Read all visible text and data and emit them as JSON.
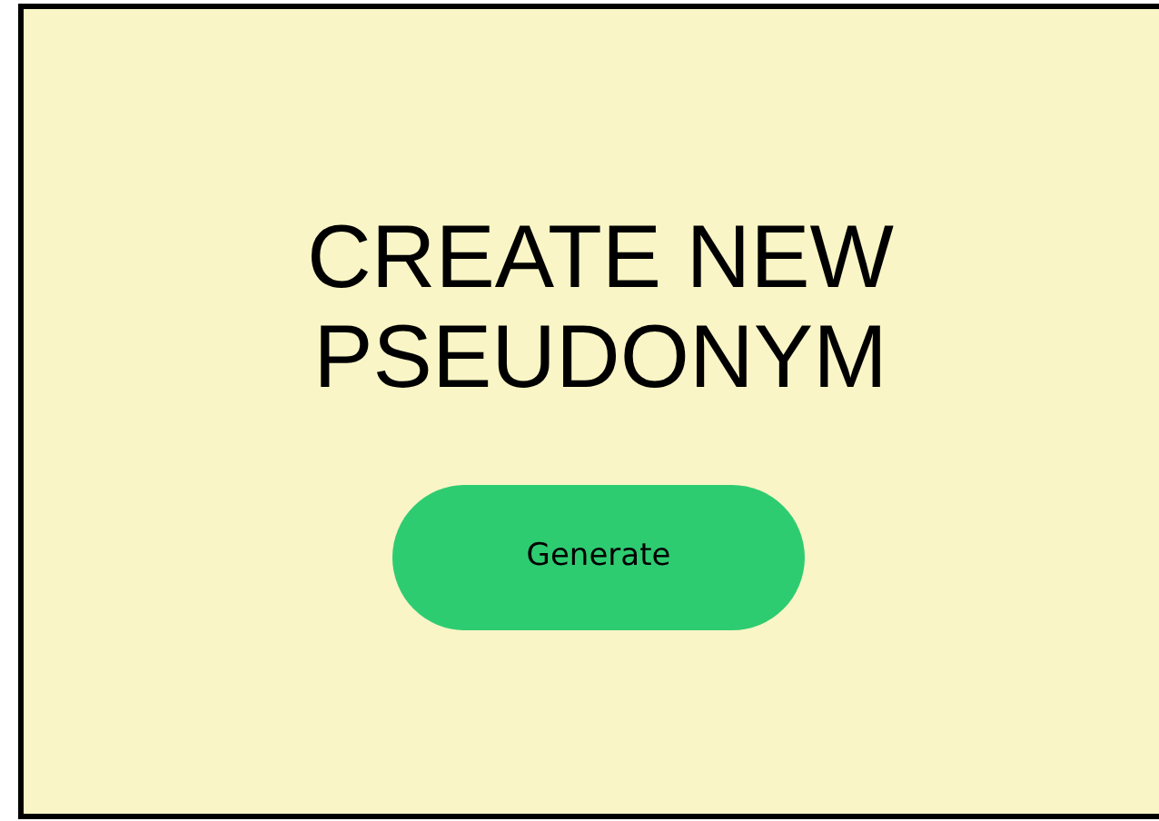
{
  "heading": "CREATE NEW PSEUDONYM",
  "button": {
    "label": "Generate"
  }
}
